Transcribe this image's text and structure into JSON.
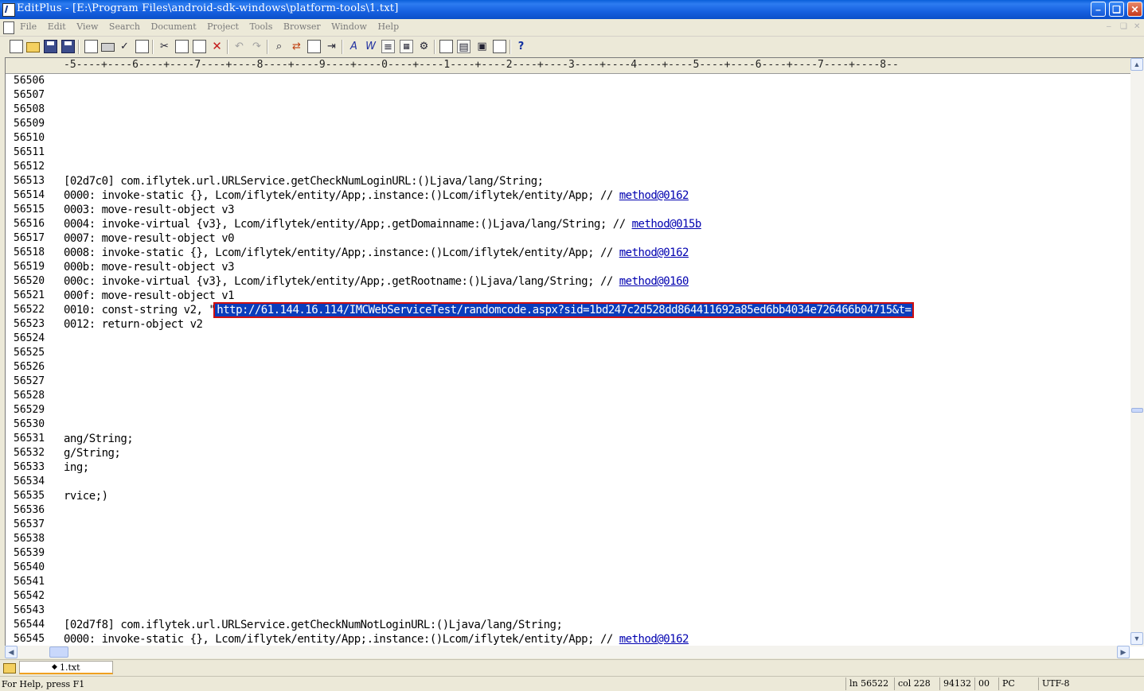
{
  "window": {
    "title": "EditPlus - [E:\\Program Files\\android-sdk-windows\\platform-tools\\1.txt]",
    "minimize": "–",
    "maximize": "❏",
    "close": "✕"
  },
  "menu": [
    "File",
    "Edit",
    "View",
    "Search",
    "Document",
    "Project",
    "Tools",
    "Browser",
    "Window",
    "Help"
  ],
  "mdi_buttons": [
    "–",
    "❏",
    "✕"
  ],
  "ruler": "-5----+----6----+----7----+----8----+----9----+----0----+----1----+----2----+----3----+----4----+----5----+----6----+----7----+----8--",
  "lines": [
    {
      "n": "56506",
      "t": ""
    },
    {
      "n": "56507",
      "t": ""
    },
    {
      "n": "56508",
      "t": ""
    },
    {
      "n": "56509",
      "t": ""
    },
    {
      "n": "56510",
      "t": ""
    },
    {
      "n": "56511",
      "t": ""
    },
    {
      "n": "56512",
      "t": ""
    },
    {
      "n": "56513",
      "t": "[02d7c0] com.iflytek.url.URLService.getCheckNumLoginURL:()Ljava/lang/String;"
    },
    {
      "n": "56514",
      "t": "0000: invoke-static {}, Lcom/iflytek/entity/App;.instance:()Lcom/iflytek/entity/App; // ",
      "link": "method@0162"
    },
    {
      "n": "56515",
      "t": "0003: move-result-object v3"
    },
    {
      "n": "56516",
      "t": "0004: invoke-virtual {v3}, Lcom/iflytek/entity/App;.getDomainname:()Ljava/lang/String; // ",
      "link": "method@015b"
    },
    {
      "n": "56517",
      "t": "0007: move-result-object v0"
    },
    {
      "n": "56518",
      "t": "0008: invoke-static {}, Lcom/iflytek/entity/App;.instance:()Lcom/iflytek/entity/App; // ",
      "link": "method@0162"
    },
    {
      "n": "56519",
      "t": "000b: move-result-object v3"
    },
    {
      "n": "56520",
      "t": "000c: invoke-virtual {v3}, Lcom/iflytek/entity/App;.getRootname:()Ljava/lang/String; // ",
      "link": "method@0160"
    },
    {
      "n": "56521",
      "t": "000f: move-result-object v1"
    },
    {
      "n": "56522",
      "t": "0010: const-string v2, \"",
      "selected": "http://61.144.16.114/IMCWebServiceTest/randomcode.aspx?sid=1bd247c2d528dd864411692a85ed6bb4034e726466b04715&t="
    },
    {
      "n": "56523",
      "t": "0012: return-object v2"
    },
    {
      "n": "56524",
      "t": ""
    },
    {
      "n": "56525",
      "t": ""
    },
    {
      "n": "56526",
      "t": ""
    },
    {
      "n": "56527",
      "t": ""
    },
    {
      "n": "56528",
      "t": ""
    },
    {
      "n": "56529",
      "t": ""
    },
    {
      "n": "56530",
      "t": ""
    },
    {
      "n": "56531",
      "t": "ang/String;"
    },
    {
      "n": "56532",
      "t": "g/String;"
    },
    {
      "n": "56533",
      "t": "ing;"
    },
    {
      "n": "56534",
      "t": ""
    },
    {
      "n": "56535",
      "t": "rvice;)"
    },
    {
      "n": "56536",
      "t": ""
    },
    {
      "n": "56537",
      "t": ""
    },
    {
      "n": "56538",
      "t": ""
    },
    {
      "n": "56539",
      "t": ""
    },
    {
      "n": "56540",
      "t": ""
    },
    {
      "n": "56541",
      "t": ""
    },
    {
      "n": "56542",
      "t": ""
    },
    {
      "n": "56543",
      "t": ""
    },
    {
      "n": "56544",
      "t": "[02d7f8] com.iflytek.url.URLService.getCheckNumNotLoginURL:()Ljava/lang/String;"
    },
    {
      "n": "56545",
      "t": "0000: invoke-static {}, Lcom/iflytek/entity/App;.instance:()Lcom/iflytek/entity/App; // ",
      "link": "method@0162"
    }
  ],
  "tab": {
    "label": "1.txt"
  },
  "status": {
    "help": "For Help, press F1",
    "ln": "ln 56522",
    "col": "col 228",
    "count": "94132",
    "mode": "00",
    "eol": "PC",
    "encoding": "UTF-8"
  },
  "colors": {
    "selection": "#0a3cbc",
    "selection_outline": "#d01010",
    "link": "#0000b0"
  }
}
